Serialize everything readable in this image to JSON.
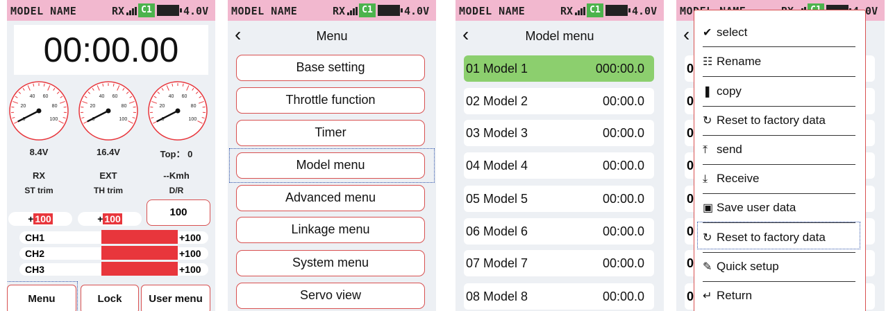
{
  "status": {
    "model_name": "MODEL NAME",
    "rx": "RX",
    "channel": "C1",
    "voltage": "4.0V"
  },
  "main": {
    "timer": "00:00.00",
    "gauges": [
      {
        "label": "8.4V",
        "sub": "RX",
        "ticks": [
          "0",
          "20",
          "40",
          "60",
          "80",
          "100"
        ]
      },
      {
        "label": "16.4V",
        "sub": "EXT",
        "ticks": [
          "0",
          "20",
          "40",
          "60",
          "80",
          "100"
        ]
      },
      {
        "label": "Top： 0",
        "sub": "--Kmh",
        "ticks": [
          "0",
          "20",
          "40",
          "60",
          "80",
          "100"
        ]
      }
    ],
    "st_trim_label": "ST trim",
    "th_trim_label": "TH trim",
    "dr_label": "D/R",
    "st_trim_sign": "+",
    "st_trim_value": "100",
    "th_trim_sign": "+",
    "th_trim_value": "100",
    "dr_value": "100",
    "channels": [
      {
        "name": "CH1",
        "value": "+100",
        "level": 1.0
      },
      {
        "name": "CH2",
        "value": "+100",
        "level": 1.0
      },
      {
        "name": "CH3",
        "value": "+100",
        "level": 1.0
      }
    ],
    "buttons": {
      "menu": "Menu",
      "lock": "Lock",
      "user_menu": "User menu"
    }
  },
  "menu": {
    "back": "‹",
    "title": "Menu",
    "items": [
      "Base setting",
      "Throttle function",
      "Timer",
      "Model menu",
      "Advanced menu",
      "Linkage menu",
      "System menu",
      "Servo view"
    ]
  },
  "model_menu": {
    "title": "Model menu",
    "items": [
      {
        "name": "01 Model 1",
        "time": "000:00.0"
      },
      {
        "name": "02 Model 2",
        "time": "00:00.0"
      },
      {
        "name": "03 Model 3",
        "time": "00:00.0"
      },
      {
        "name": "04 Model 4",
        "time": "00:00.0"
      },
      {
        "name": "05 Model 5",
        "time": "00:00.0"
      },
      {
        "name": "06 Model 6",
        "time": "00:00.0"
      },
      {
        "name": "07 Model 7",
        "time": "00:00.0"
      },
      {
        "name": "08 Model 8",
        "time": "00:00.0"
      }
    ]
  },
  "popup": {
    "items": [
      {
        "icon": "check-icon",
        "glyph": "✔",
        "label": "select"
      },
      {
        "icon": "rename-icon",
        "glyph": "☷",
        "label": "Rename"
      },
      {
        "icon": "copy-icon",
        "glyph": "❚",
        "label": "copy"
      },
      {
        "icon": "refresh-icon",
        "glyph": "↻",
        "label": "Reset to factory data"
      },
      {
        "icon": "upload-icon",
        "glyph": "⤒",
        "label": "send"
      },
      {
        "icon": "download-icon",
        "glyph": "⤓",
        "label": "Receive"
      },
      {
        "icon": "save-icon",
        "glyph": "▣",
        "label": "Save user data"
      },
      {
        "icon": "refresh-icon",
        "glyph": "↻",
        "label": "Reset to factory data"
      },
      {
        "icon": "pencil-icon",
        "glyph": "✎",
        "label": "Quick setup"
      },
      {
        "icon": "return-icon",
        "glyph": "↵",
        "label": "Return"
      }
    ],
    "bg_rows": [
      "0",
      "0",
      "0",
      "0",
      "0",
      "0",
      "0",
      "0",
      "0"
    ]
  },
  "colors": {
    "status_bar": "#f2b8cf",
    "accent_red": "#e8363c",
    "border_red": "#d85050",
    "selected_green": "#8ccf6e",
    "channel_green": "#4cb34c",
    "focus_blue": "#2a4fa8"
  }
}
